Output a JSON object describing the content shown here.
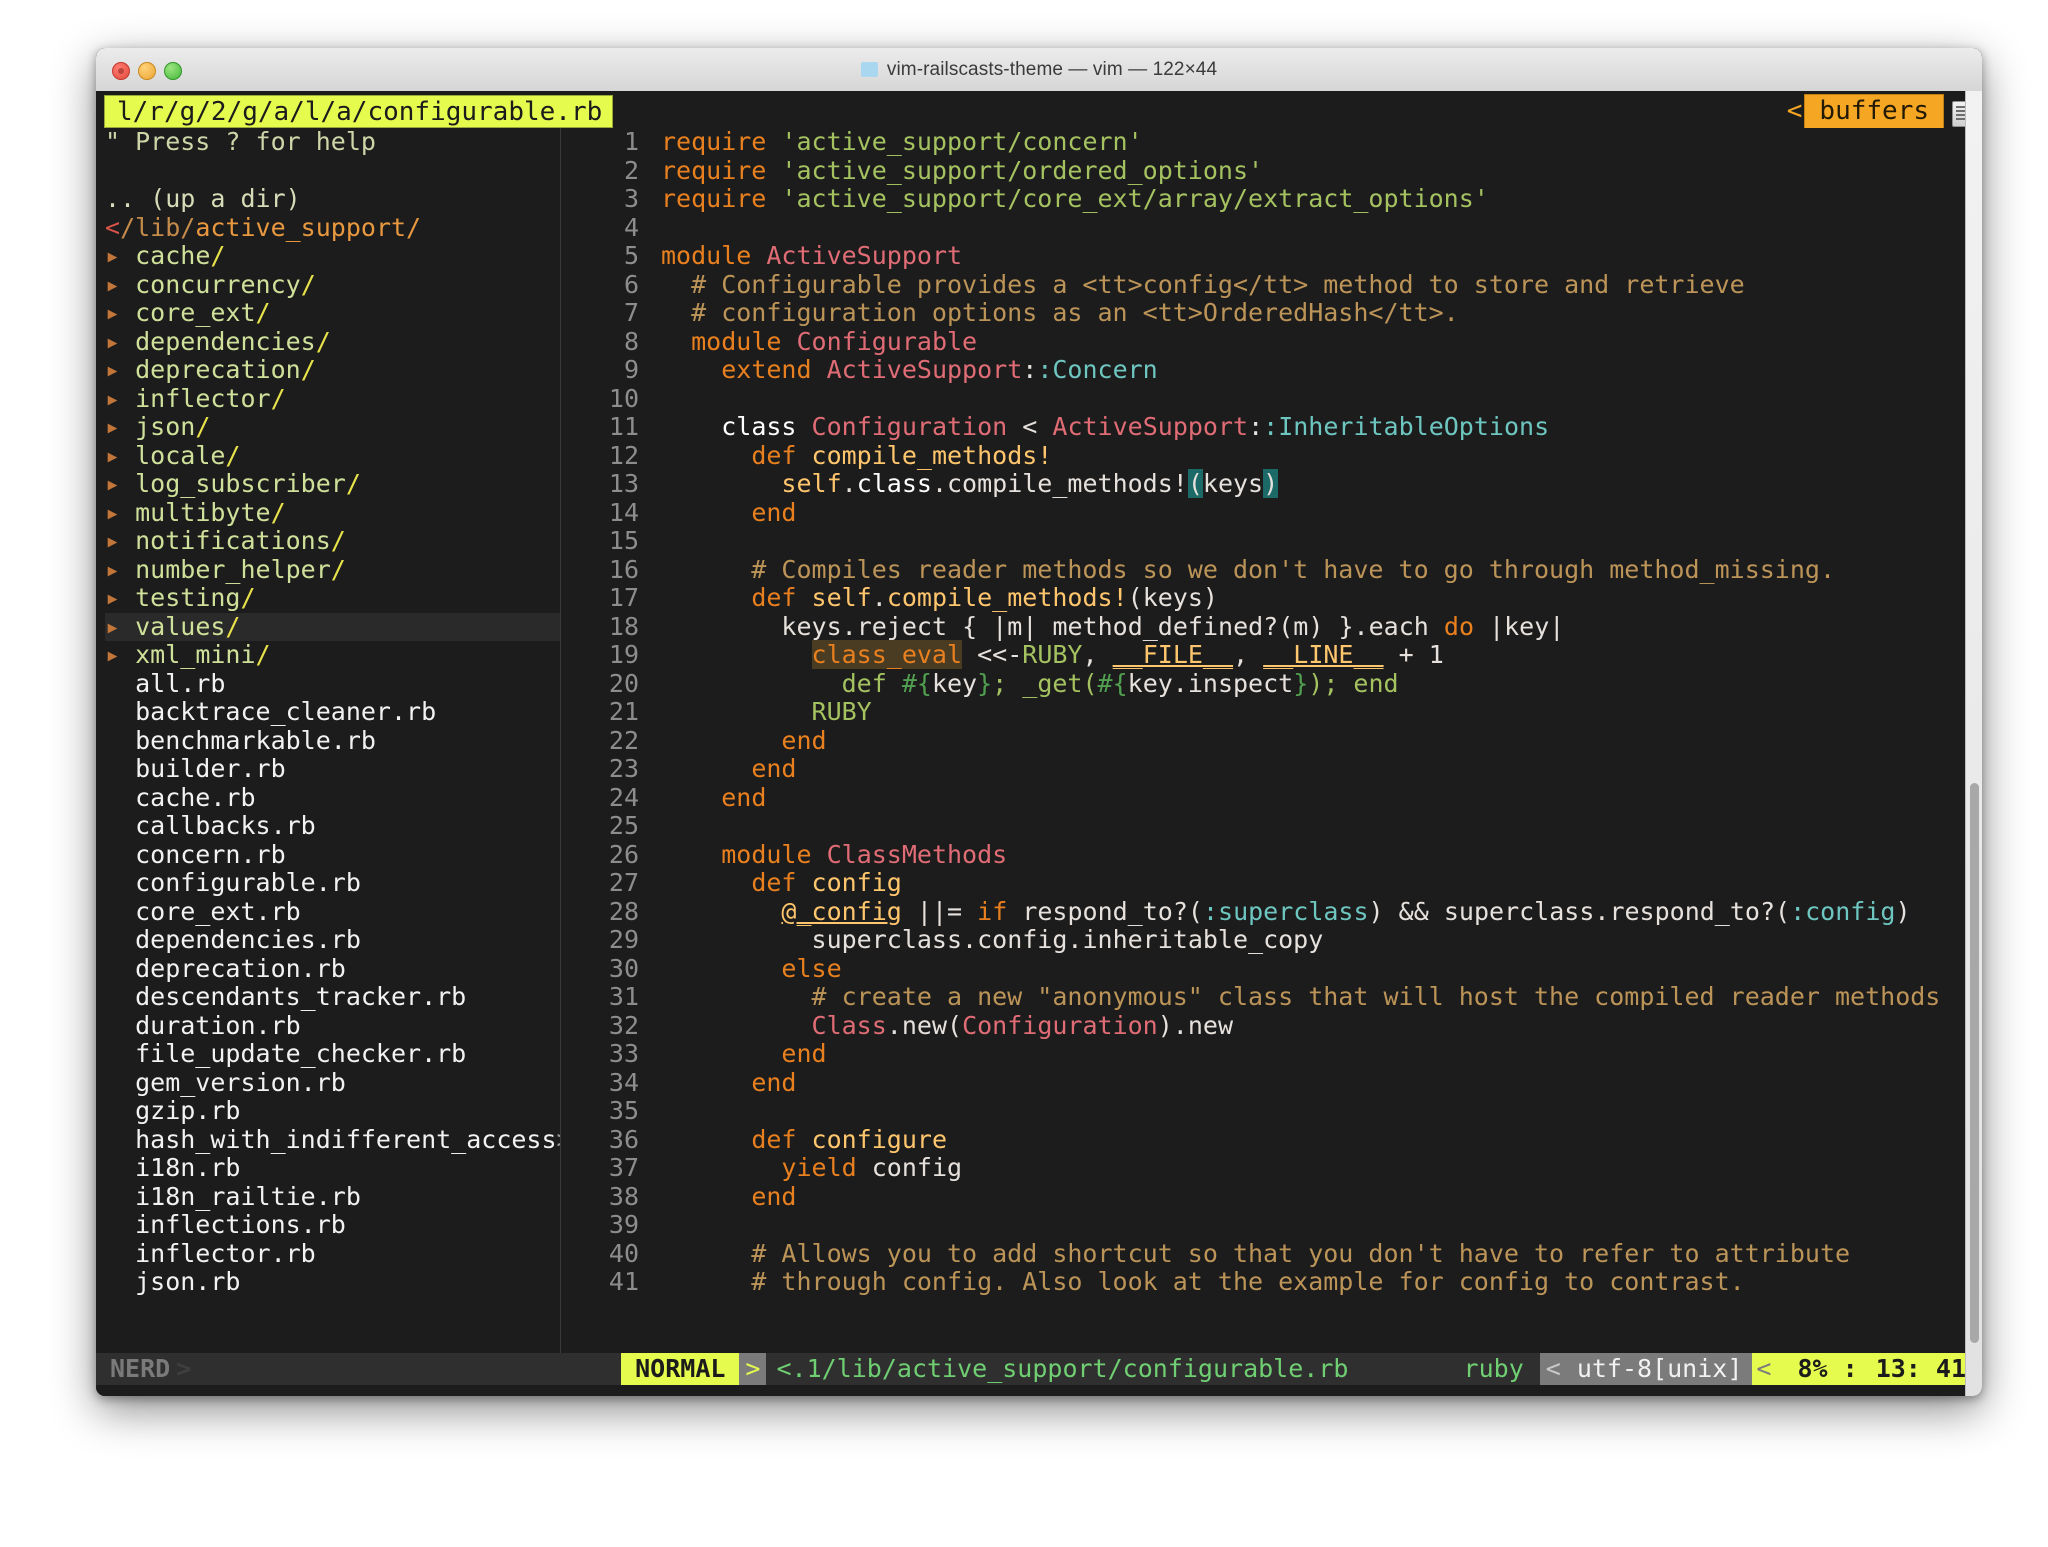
{
  "window": {
    "title": "vim-railscasts-theme — vim — 122×44",
    "traffic_lights": [
      "close",
      "minimize",
      "maximize"
    ]
  },
  "tabline": {
    "active_tab": "l/r/g/2/g/a/l/a/configurable.rb",
    "right_chevron": "<",
    "buffers_label": "buffers"
  },
  "nerdtree": {
    "help_hint": "\" Press ? for help",
    "up_dir": ".. (up a dir)",
    "root_marker": "<",
    "root_dim": "/lib/",
    "root_name": "active_support/",
    "arrow": "▸",
    "directories": [
      "cache",
      "concurrency",
      "core_ext",
      "dependencies",
      "deprecation",
      "inflector",
      "json",
      "locale",
      "log_subscriber",
      "multibyte",
      "notifications",
      "number_helper",
      "testing",
      "values",
      "xml_mini"
    ],
    "selected_directory": "values",
    "files": [
      "all.rb",
      "backtrace_cleaner.rb",
      "benchmarkable.rb",
      "builder.rb",
      "cache.rb",
      "callbacks.rb",
      "concern.rb",
      "configurable.rb",
      "core_ext.rb",
      "dependencies.rb",
      "deprecation.rb",
      "descendants_tracker.rb",
      "duration.rb",
      "file_update_checker.rb",
      "gem_version.rb",
      "gzip.rb",
      "hash_with_indifferent_access",
      "i18n.rb",
      "i18n_railtie.rb",
      "inflections.rb",
      "inflector.rb",
      "json.rb"
    ],
    "truncated_file": "hash_with_indifferent_access",
    "truncation_marker": ">"
  },
  "code": {
    "filename": "configurable.rb",
    "language": "ruby",
    "first_line": 1,
    "last_line": 41,
    "lines": [
      {
        "n": 1,
        "text": "require 'active_support/concern'"
      },
      {
        "n": 2,
        "text": "require 'active_support/ordered_options'"
      },
      {
        "n": 3,
        "text": "require 'active_support/core_ext/array/extract_options'"
      },
      {
        "n": 4,
        "text": ""
      },
      {
        "n": 5,
        "text": "module ActiveSupport"
      },
      {
        "n": 6,
        "text": "  # Configurable provides a <tt>config</tt> method to store and retrieve"
      },
      {
        "n": 7,
        "text": "  # configuration options as an <tt>OrderedHash</tt>."
      },
      {
        "n": 8,
        "text": "  module Configurable"
      },
      {
        "n": 9,
        "text": "    extend ActiveSupport::Concern"
      },
      {
        "n": 10,
        "text": ""
      },
      {
        "n": 11,
        "text": "    class Configuration < ActiveSupport::InheritableOptions"
      },
      {
        "n": 12,
        "text": "      def compile_methods!"
      },
      {
        "n": 13,
        "text": "        self.class.compile_methods!(keys)"
      },
      {
        "n": 14,
        "text": "      end"
      },
      {
        "n": 15,
        "text": ""
      },
      {
        "n": 16,
        "text": "      # Compiles reader methods so we don't have to go through method_missing."
      },
      {
        "n": 17,
        "text": "      def self.compile_methods!(keys)"
      },
      {
        "n": 18,
        "text": "        keys.reject { |m| method_defined?(m) }.each do |key|"
      },
      {
        "n": 19,
        "text": "          class_eval <<-RUBY, __FILE__, __LINE__ + 1"
      },
      {
        "n": 20,
        "text": "            def #{key}; _get(#{key.inspect}); end"
      },
      {
        "n": 21,
        "text": "          RUBY"
      },
      {
        "n": 22,
        "text": "        end"
      },
      {
        "n": 23,
        "text": "      end"
      },
      {
        "n": 24,
        "text": "    end"
      },
      {
        "n": 25,
        "text": ""
      },
      {
        "n": 26,
        "text": "    module ClassMethods"
      },
      {
        "n": 27,
        "text": "      def config"
      },
      {
        "n": 28,
        "text": "        @_config ||= if respond_to?(:superclass) && superclass.respond_to?(:config)"
      },
      {
        "n": 29,
        "text": "          superclass.config.inheritable_copy"
      },
      {
        "n": 30,
        "text": "        else"
      },
      {
        "n": 31,
        "text": "          # create a new \"anonymous\" class that will host the compiled reader methods"
      },
      {
        "n": 32,
        "text": "          Class.new(Configuration).new"
      },
      {
        "n": 33,
        "text": "        end"
      },
      {
        "n": 34,
        "text": "      end"
      },
      {
        "n": 35,
        "text": ""
      },
      {
        "n": 36,
        "text": "      def configure"
      },
      {
        "n": 37,
        "text": "        yield config"
      },
      {
        "n": 38,
        "text": "      end"
      },
      {
        "n": 39,
        "text": ""
      },
      {
        "n": 40,
        "text": "      # Allows you to add shortcut so that you don't have to refer to attribute"
      },
      {
        "n": 41,
        "text": "      # through config. Also look at the example for config to contrast."
      }
    ]
  },
  "statusline": {
    "nerd_label": "NERD",
    "nerd_chevron": ">",
    "mode": "NORMAL",
    "mode_chevron": ">",
    "file_path": "<.1/lib/active_support/configurable.rb",
    "filetype": "ruby",
    "ft_chevron": "<",
    "encoding": "utf-8[unix]",
    "enc_chevron": "<",
    "percent": "8% :",
    "position": "13: 41"
  },
  "colors": {
    "accent_yellow": "#e5fb4e",
    "accent_orange": "#f5a623",
    "background": "#1c1c1c",
    "foreground": "#e6e1dc",
    "string_green": "#a5c261",
    "comment_brown": "#bc9458",
    "class_red": "#e06c75",
    "method_yellow": "#ffc66d",
    "symbol_teal": "#6ec6c0",
    "status_gray": "#2f2f2f"
  }
}
